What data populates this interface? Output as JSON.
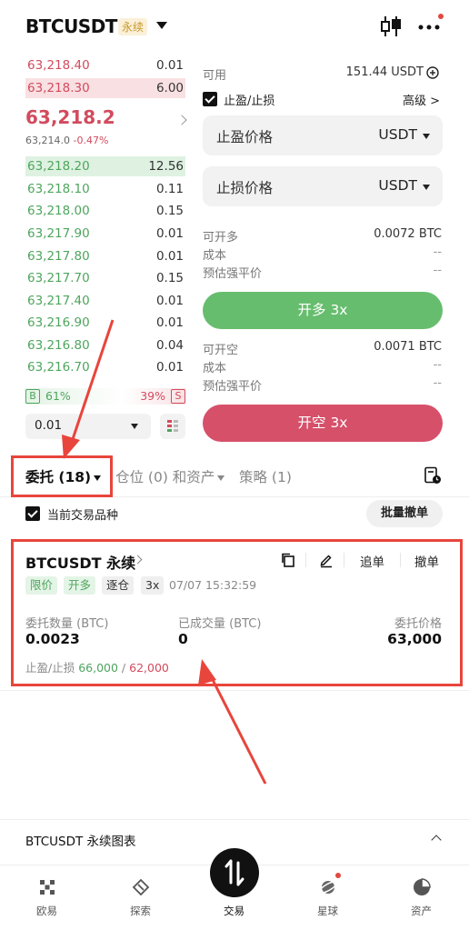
{
  "header": {
    "symbol": "BTCUSDT",
    "contract_badge": "永续"
  },
  "orderbook": {
    "asks": [
      {
        "price": "63,218.40",
        "qty": "0.01"
      },
      {
        "price": "63,218.30",
        "qty": "6.00"
      }
    ],
    "mid_price": "63,218.2",
    "mark_price": "63,214.0",
    "change": "-0.47%",
    "bids": [
      {
        "price": "63,218.20",
        "qty": "12.56"
      },
      {
        "price": "63,218.10",
        "qty": "0.11"
      },
      {
        "price": "63,218.00",
        "qty": "0.15"
      },
      {
        "price": "63,217.90",
        "qty": "0.01"
      },
      {
        "price": "63,217.80",
        "qty": "0.01"
      },
      {
        "price": "63,217.70",
        "qty": "0.15"
      },
      {
        "price": "63,217.40",
        "qty": "0.01"
      },
      {
        "price": "63,216.90",
        "qty": "0.01"
      },
      {
        "price": "63,216.80",
        "qty": "0.04"
      },
      {
        "price": "63,216.70",
        "qty": "0.01"
      }
    ],
    "buy_ratio_label": "B",
    "buy_ratio": "61%",
    "sell_ratio": "39%",
    "sell_ratio_label": "S",
    "buy_ratio_fraction": 0.61,
    "depth_step": "0.01"
  },
  "order_form": {
    "available_label": "可用",
    "available_value": "151.44 USDT",
    "tpsl_label": "止盈/止损",
    "advanced_label": "高级 >",
    "tp_placeholder": "止盈价格",
    "sl_placeholder": "止损价格",
    "unit": "USDT",
    "long": {
      "max_label": "可开多",
      "max_value": "0.0072 BTC",
      "cost_label": "成本",
      "cost_value": "--",
      "liq_label": "预估强平价",
      "liq_value": "--",
      "button": "开多 3x"
    },
    "short": {
      "max_label": "可开空",
      "max_value": "0.0071 BTC",
      "cost_label": "成本",
      "cost_value": "--",
      "liq_label": "预估强平价",
      "liq_value": "--",
      "button": "开空 3x"
    }
  },
  "tabs": {
    "orders": "委托 (18)",
    "positions": "仓位 (0) 和资产",
    "strategies": "策略 (1)"
  },
  "filter": {
    "current_symbol_label": "当前交易品种",
    "batch_cancel": "批量撤单"
  },
  "order_card": {
    "title": "BTCUSDT 永续",
    "chase_label": "追单",
    "cancel_label": "撤单",
    "tags": [
      "限价",
      "开多",
      "逐仓",
      "3x"
    ],
    "time": "07/07 15:32:59",
    "qty_label": "委托数量 (BTC)",
    "qty_value": "0.0023",
    "filled_label": "已成交量 (BTC)",
    "filled_value": "0",
    "price_label": "委托价格",
    "price_value": "63,000",
    "tpsl_label": "止盈/止损",
    "tp_value": "66,000",
    "sep": " / ",
    "sl_value": "62,000"
  },
  "chart_bar": {
    "title": "BTCUSDT 永续图表"
  },
  "bottom_nav": [
    {
      "label": "欧易",
      "icon": "okx-logo-icon"
    },
    {
      "label": "探索",
      "icon": "compass-icon"
    },
    {
      "label": "交易",
      "icon": "trade-arrows-icon"
    },
    {
      "label": "星球",
      "icon": "planet-icon"
    },
    {
      "label": "资产",
      "icon": "pie-chart-icon"
    }
  ],
  "colors": {
    "up": "#4ea55d",
    "down": "#d24b5d",
    "long_button": "#67bd6e",
    "short_button": "#d6506a",
    "annotation": "#e8453c"
  }
}
